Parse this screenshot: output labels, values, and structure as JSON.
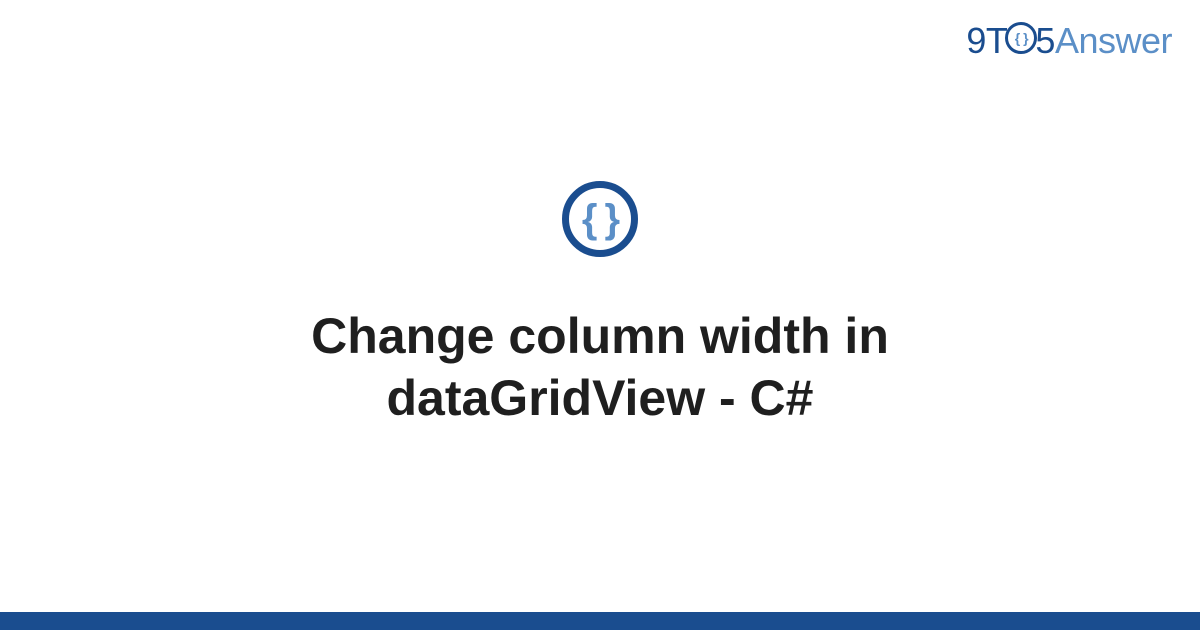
{
  "logo": {
    "part1": "9T",
    "circle_inner": "{ }",
    "part2": "5",
    "part3": "Answer"
  },
  "icon": {
    "glyph": "{ }"
  },
  "title": "Change column width in dataGridView - C#",
  "colors": {
    "primary": "#1a4d8f",
    "accent": "#5b8fc7"
  }
}
